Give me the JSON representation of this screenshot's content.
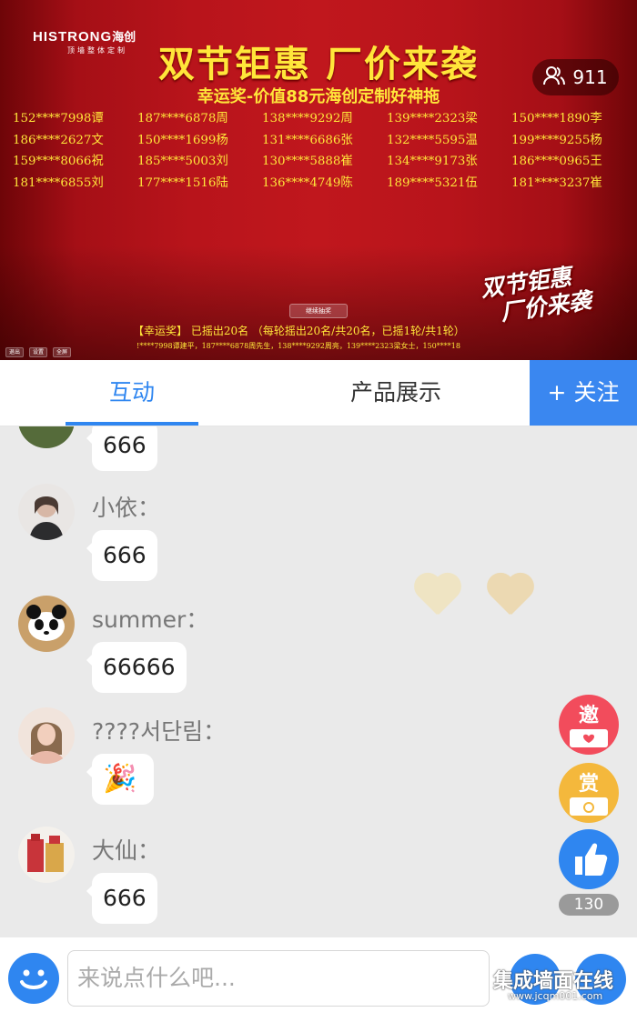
{
  "video": {
    "logo_brand": "HISTRONG",
    "logo_cn": "海创",
    "logo_sub": "顶墙整体定制",
    "headline": "双节钜惠 厂价来袭",
    "subheadline": "幸运奖-价值88元海创定制好神拖",
    "viewer_count": "911",
    "winners": [
      "152****7998谭",
      "187****6878周",
      "138****9292周",
      "139****2323梁",
      "150****1890李",
      "186****2627文",
      "150****1699杨",
      "131****6686张",
      "132****5595温",
      "199****9255杨",
      "159****8066祝",
      "185****5003刘",
      "130****5888崔",
      "134****9173张",
      "186****0965王",
      "181****6855刘",
      "177****1516陆",
      "136****4749陈",
      "189****5321伍",
      "181****3237崔"
    ],
    "continue_button": "继续抽奖",
    "status_text": "【幸运奖】 已摇出20名 （每轮摇出20名/共20名，已摇1轮/共1轮）",
    "ticker_text": "!****7998谭建平，187****6878周先生，138****9292周亮，139****2323梁女士，150****18",
    "promo_line1": "双节钜惠",
    "promo_line2": "厂价来袭",
    "tiny_controls": [
      "退出",
      "设置",
      "全屏"
    ]
  },
  "tabs": {
    "interact": "互动",
    "products": "产品展示",
    "follow": "+ 关注"
  },
  "chat": {
    "messages": [
      {
        "user": "",
        "text": "666"
      },
      {
        "user": "小依：",
        "text": "666"
      },
      {
        "user": "summer：",
        "text": "66666"
      },
      {
        "user": "????서단림：",
        "text": "🎉"
      },
      {
        "user": "大仙：",
        "text": "666"
      }
    ]
  },
  "actions": {
    "invite": "邀",
    "reward": "赏",
    "like_count": "130"
  },
  "bottom": {
    "input_placeholder": "来说点什么吧..."
  },
  "watermark": {
    "line1": "集成墙面在线",
    "line2": "www.jcqm001.com"
  },
  "colors": {
    "accent": "#2f86f0",
    "banner_red": "#c0171d",
    "banner_text": "#ffe63a",
    "invite": "#f24c5c",
    "reward": "#f4b83c"
  }
}
